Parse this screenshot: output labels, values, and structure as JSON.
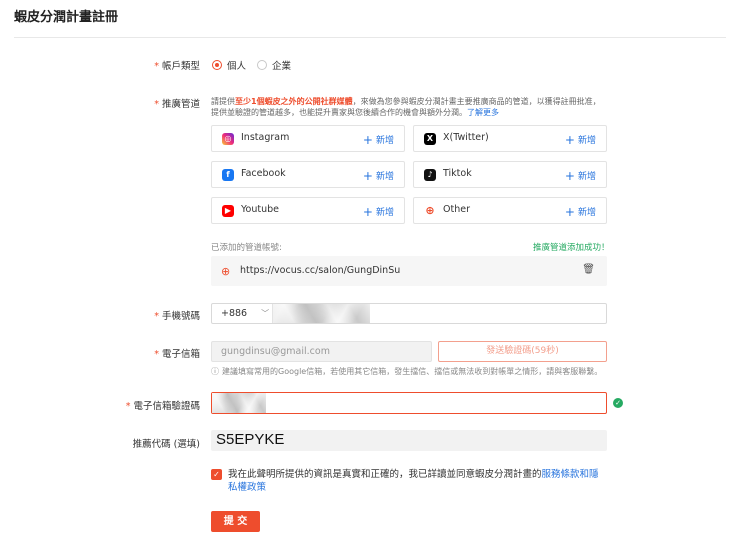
{
  "page": {
    "title": "蝦皮分潤計畫註冊"
  },
  "account_type": {
    "label": "帳戶類型",
    "options": [
      {
        "label": "個人",
        "selected": true
      },
      {
        "label": "企業",
        "selected": false
      }
    ]
  },
  "channels": {
    "label": "推廣管道",
    "desc_1": "請提供",
    "desc_highlight": "至少1個蝦皮之外的公開社群媒體",
    "desc_2": "，來做為您參與蝦皮分潤計畫主要推廣商品的管道，以獲得註冊批准，提供並驗證的管道越多，也能提升賣家與您後續合作的機會與額外分潤。",
    "desc_link": "了解更多",
    "add_label": "新增",
    "cards": [
      {
        "name": "Instagram",
        "icon": "instagram-icon",
        "color": "#d62976"
      },
      {
        "name": "X(Twitter)",
        "icon": "x-twitter-icon",
        "color": "#000000"
      },
      {
        "name": "Facebook",
        "icon": "facebook-icon",
        "color": "#1877f2"
      },
      {
        "name": "Tiktok",
        "icon": "tiktok-icon",
        "color": "#111111"
      },
      {
        "name": "Youtube",
        "icon": "youtube-icon",
        "color": "#ff0000"
      },
      {
        "name": "Other",
        "icon": "globe-icon",
        "color": "#ee4d2d"
      }
    ],
    "added_title": "已添加的管道帳號:",
    "added_status": "推廣管道添加成功！",
    "added_url": "https://vocus.cc/salon/GungDinSu"
  },
  "phone": {
    "label": "手機號碼",
    "country_code": "+886"
  },
  "email": {
    "label": "電子信箱",
    "value": "gungdinsu@gmail.com",
    "send_button": "發送驗證碼(59秒)",
    "hint": "建議填寫常用的Google信箱，若使用其它信箱，發生擋信、擋信或無法收到對帳單之情形，請與客服聯繫。"
  },
  "email_code": {
    "label": "電子信箱驗證碼"
  },
  "referral": {
    "label": "推薦代碼 (選填)",
    "value": "S5EPYKE"
  },
  "agreement": {
    "text": "我在此聲明所提供的資訊是真實和正確的，我已詳讀並同意蝦皮分潤計畫的",
    "link": "服務條款和隱私權政策",
    "checked": true
  },
  "submit": {
    "label": "提 交"
  },
  "colors": {
    "accent": "#ee4d2d",
    "link": "#2673dd",
    "success": "#26aa62"
  }
}
